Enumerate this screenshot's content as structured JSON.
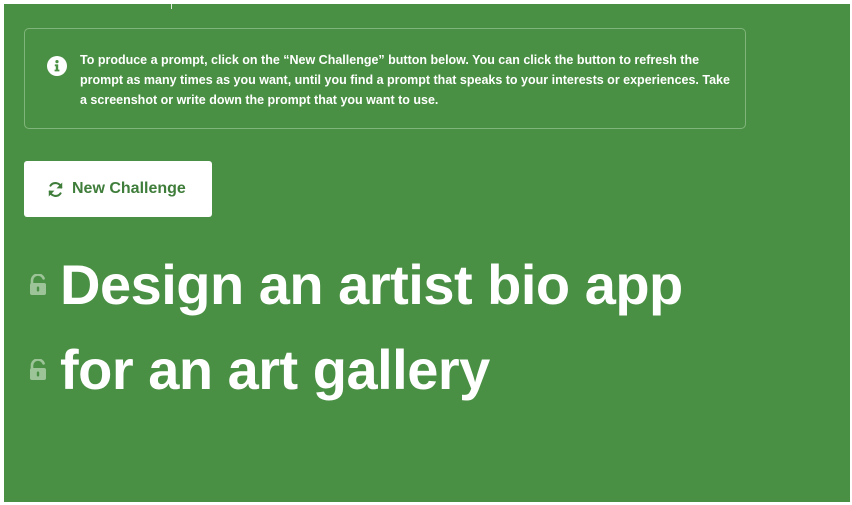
{
  "info": {
    "icon": "info-icon",
    "text": "To produce a prompt, click on the “New Challenge” button below. You can click the button to refresh the prompt as many times as you want, until you find a prompt that speaks to your interests or experiences. Take a screenshot or write down the prompt that you want to use."
  },
  "button": {
    "label": "New Challenge",
    "icon": "refresh-icon"
  },
  "prompt": {
    "part1": "Design an artist bio app",
    "part2": "for an art gallery",
    "icon": "unlock-icon"
  },
  "colors": {
    "background": "#4a9044",
    "button_text": "#3f7d3a",
    "lock_icon": "#9cc498"
  }
}
